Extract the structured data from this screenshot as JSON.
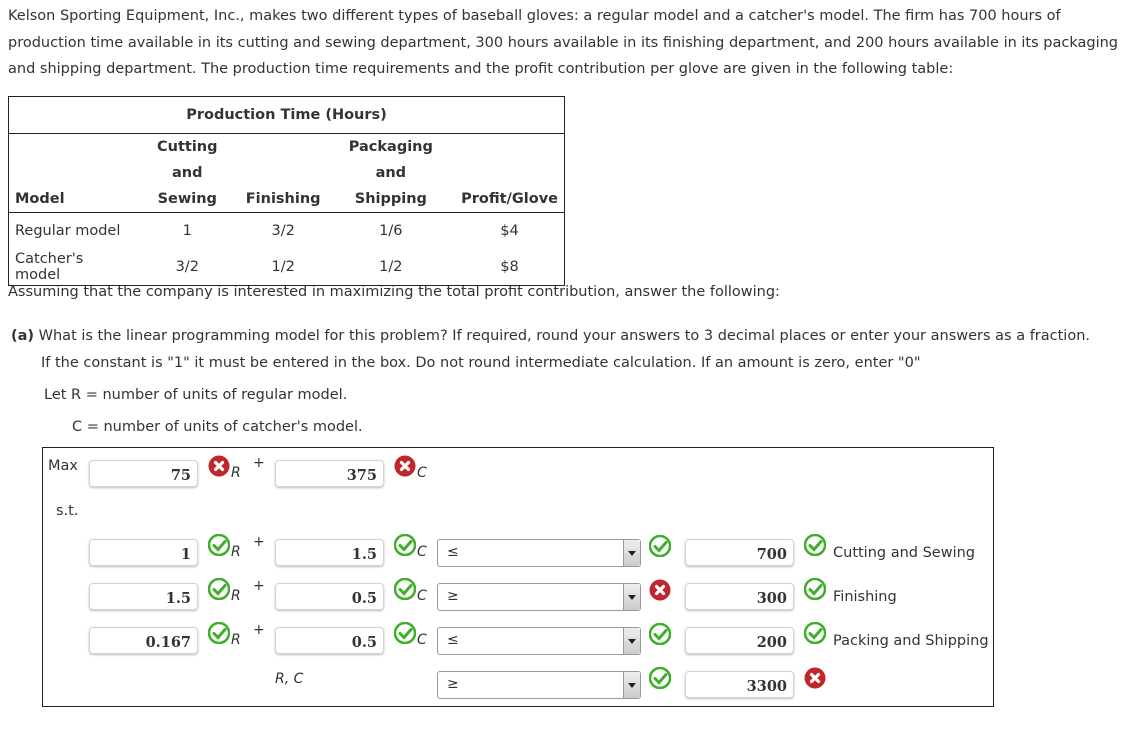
{
  "intro": "Kelson Sporting Equipment, Inc., makes two different types of baseball gloves: a regular model and a catcher's model. The firm has 700 hours of production time available in its cutting and sewing department, 300 hours available in its finishing department, and 200 hours available in its packaging and shipping department. The production time requirements and the profit contribution per glove are given in the following table:",
  "table": {
    "group_header": "Production Time (Hours)",
    "headers": [
      [
        "Model"
      ],
      [
        "Cutting and",
        "Sewing"
      ],
      [
        "Finishing"
      ],
      [
        "Packaging and",
        "Shipping"
      ],
      [
        "Profit/Glove"
      ]
    ],
    "rows": [
      [
        "Regular model",
        "1",
        "3/2",
        "1/6",
        "$4"
      ],
      [
        "Catcher's model",
        "3/2",
        "1/2",
        "1/2",
        "$8"
      ]
    ]
  },
  "assume": "Assuming that the company is interested in maximizing the total profit contribution, answer the following:",
  "part_a": {
    "label": "(a)",
    "question": "What is the linear programming model for this problem? If required, round your answers to 3 decimal places or enter your answers as a fraction.",
    "instructions": "If the constant is \"1\" it must be entered in the box. Do not round intermediate calculation. If an amount is zero, enter \"0\"",
    "let_r": "Let R = number of units of regular model.",
    "let_c": "C = number of units of catcher's model."
  },
  "model": {
    "max_label": "Max",
    "st_label": "s.t.",
    "var_r": "R",
    "var_c": "C",
    "plus": "+",
    "nonneg_vars": "R, C",
    "objective": {
      "r": "75",
      "r_status": "incorrect",
      "c": "375",
      "c_status": "incorrect"
    },
    "constraints": [
      {
        "r": "1",
        "r_status": "correct",
        "c": "1.5",
        "c_status": "correct",
        "op": "≤",
        "op_status": "correct",
        "rhs": "700",
        "rhs_status": "correct",
        "label": "Cutting and Sewing"
      },
      {
        "r": "1.5",
        "r_status": "correct",
        "c": "0.5",
        "c_status": "correct",
        "op": "≥",
        "op_status": "incorrect",
        "rhs": "300",
        "rhs_status": "correct",
        "label": "Finishing"
      },
      {
        "r": "0.167",
        "r_status": "correct",
        "c": "0.5",
        "c_status": "correct",
        "op": "≤",
        "op_status": "correct",
        "rhs": "200",
        "rhs_status": "correct",
        "label": "Packing and Shipping"
      }
    ],
    "nonneg": {
      "op": "≥",
      "op_status": "correct",
      "rhs": "3300",
      "rhs_status": "incorrect"
    }
  },
  "colors": {
    "correct": "#3fae2a",
    "incorrect": "#c0262c"
  }
}
